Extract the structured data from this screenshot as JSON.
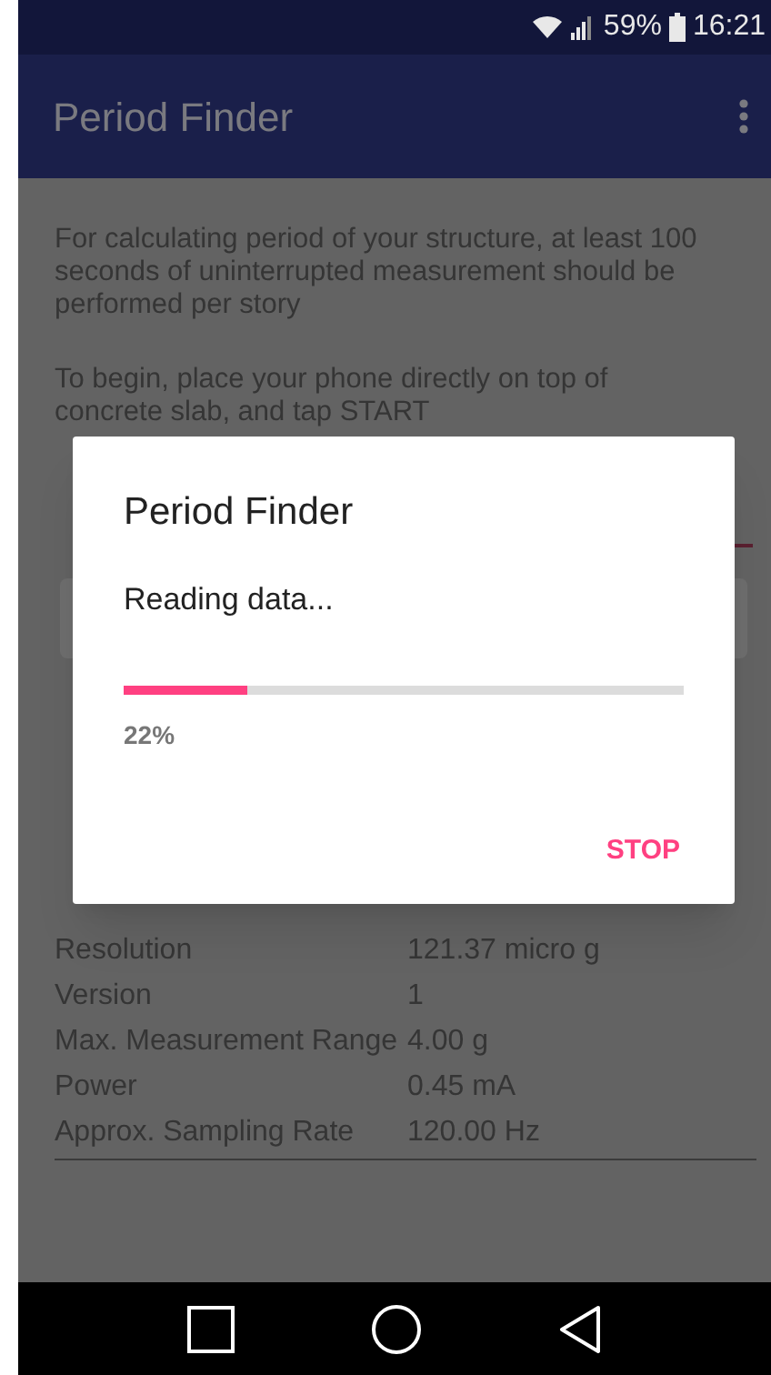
{
  "status_bar": {
    "battery": "59%",
    "time": "16:21"
  },
  "app_bar": {
    "title": "Period Finder"
  },
  "instructions": [
    "For calculating period of your structure, at least 100 seconds of uninterrupted measurement should be performed per story",
    "To begin, place your phone directly on top of concrete slab, and tap START"
  ],
  "sensor_info": [
    {
      "label": "Resolution",
      "value": "121.37 micro g"
    },
    {
      "label": "Version",
      "value": "1"
    },
    {
      "label": "Max. Measurement Range",
      "value": "4.00 g"
    },
    {
      "label": "Power",
      "value": "0.45 mA"
    },
    {
      "label": "Approx. Sampling Rate",
      "value": "120.00 Hz"
    }
  ],
  "dialog": {
    "title": "Period Finder",
    "message": "Reading data...",
    "level": 0.22,
    "percent": "22%",
    "button": "STOP"
  }
}
